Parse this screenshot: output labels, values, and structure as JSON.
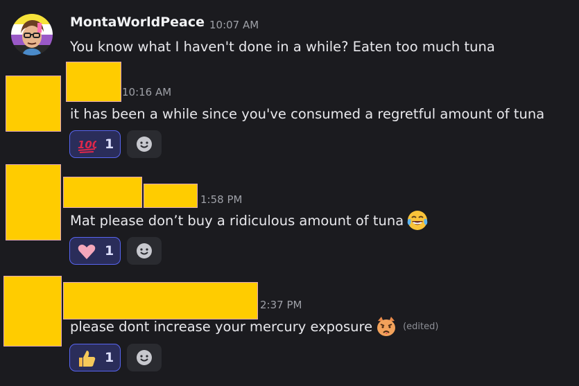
{
  "messages": [
    {
      "username": "MontaWorldPeace",
      "time": "10:07 AM",
      "text": "You know what I haven't done in a while? Eaten too much tuna"
    },
    {
      "time": "10:16 AM",
      "text": "it has been a while since you've consumed a regretful amount of tuna",
      "reaction": {
        "emoji": "hundred-points",
        "count": "1"
      }
    },
    {
      "time": "1:58 PM",
      "text": "Mat please don’t buy a ridiculous amount of tuna",
      "inline_emoji": "face-with-tears-of-joy",
      "reaction": {
        "emoji": "pink-heart",
        "count": "1"
      }
    },
    {
      "time": "2:37 PM",
      "text": "please dont increase your mercury exposure",
      "inline_emoji": "pouting-cat-face",
      "edited_label": "(edited)",
      "reaction": {
        "emoji": "thumbs-up",
        "count": "1"
      }
    }
  ],
  "colors": {
    "background": "#1b1b1f",
    "redaction": "#ffcc00",
    "reaction_border": "#5865f2",
    "reaction_bg": "#2a2d5a"
  }
}
